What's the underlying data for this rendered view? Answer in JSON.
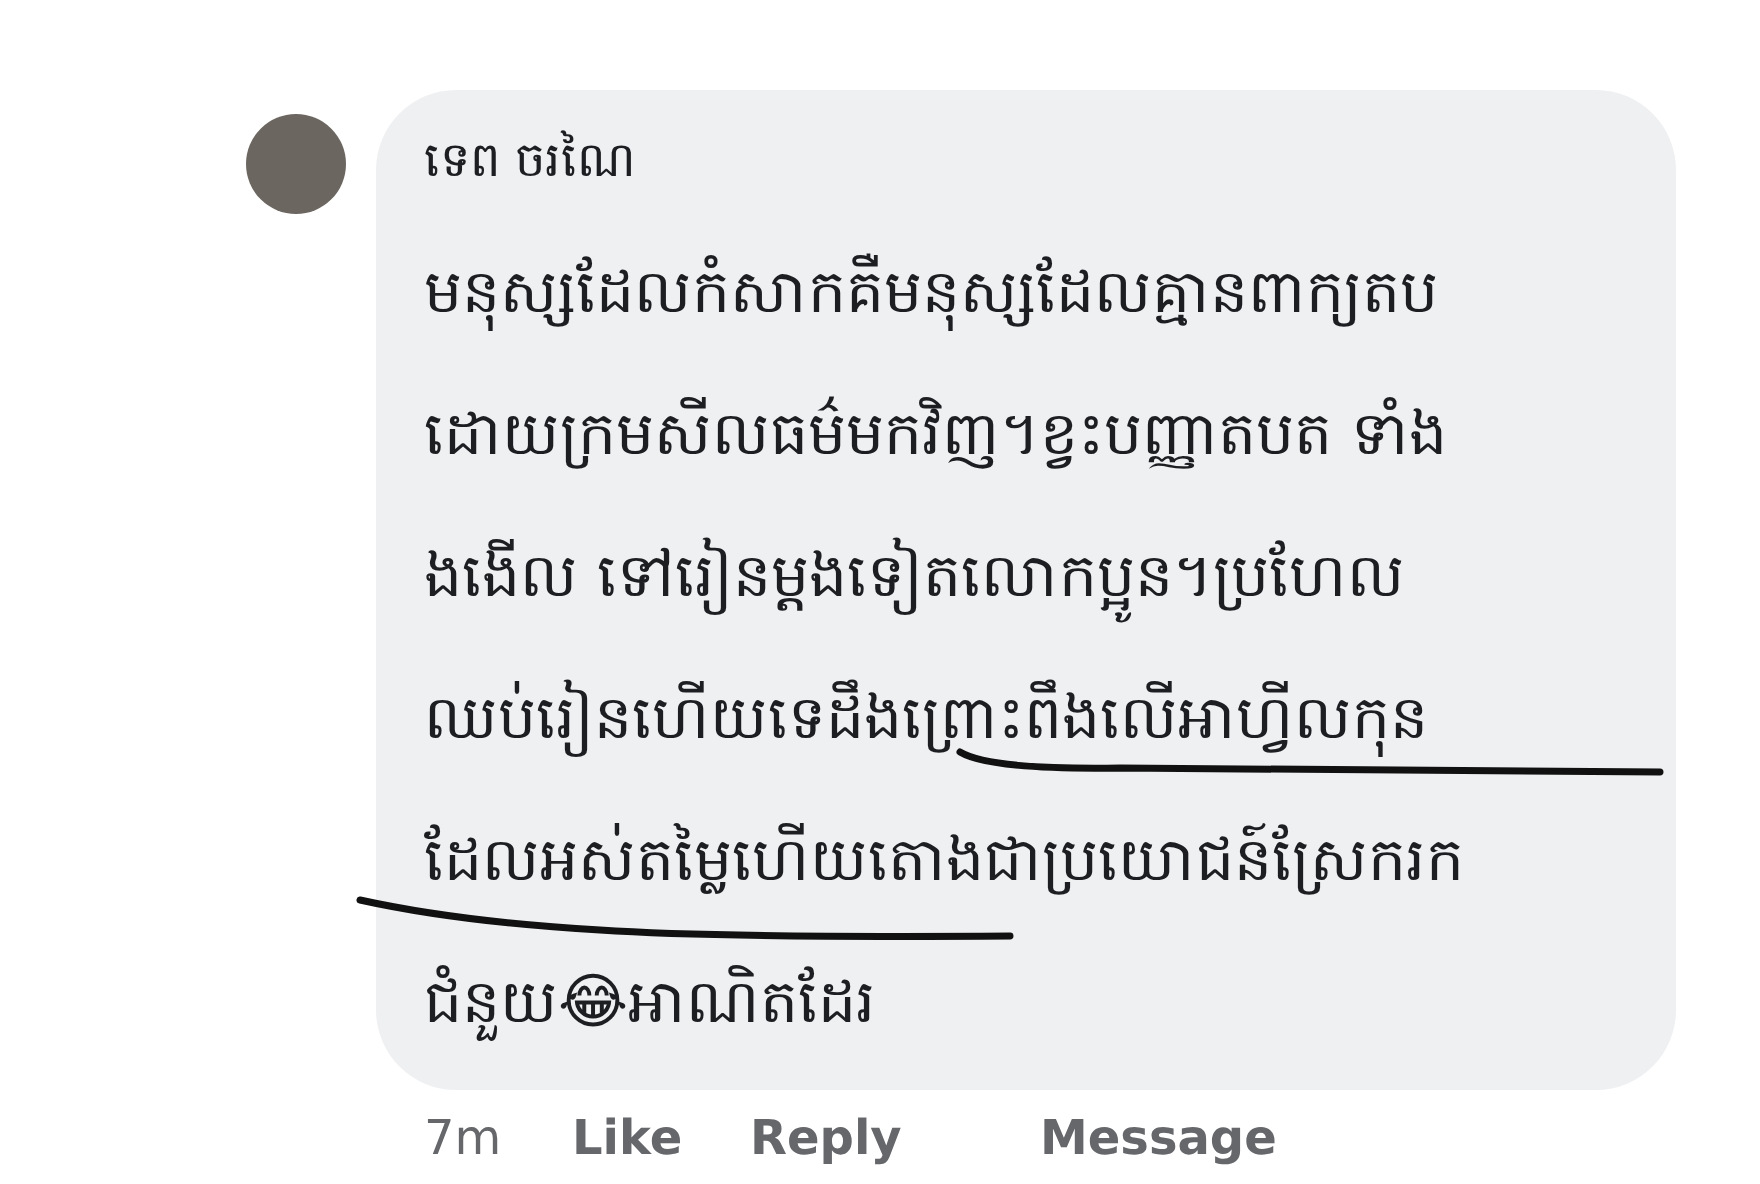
{
  "comment": {
    "author": "ទេព ចរណៃ",
    "text_lines": [
      "មនុស្សដែលកំសាកគឺមនុស្សដែលគ្មានពាក្យតប",
      "ដោយក្រមសីលធម៌មកវិញ។ខ្វះបញ្ញាតបត ទាំង",
      "ងងើល ទៅរៀនម្តងទៀតលោកប្អូន។ប្រហែល",
      "ឈប់រៀនហើយទេដឹងព្រោះពឹងលើអាហ្វីលកុន",
      "ដែលអស់តម្លៃហើយតោងជាប្រយោជន៍ស្រែករក",
      "ជំនួយ😂អាណិតដែរ"
    ],
    "actions": {
      "time": "7m",
      "like": "Like",
      "reply": "Reply",
      "message": "Message"
    }
  }
}
